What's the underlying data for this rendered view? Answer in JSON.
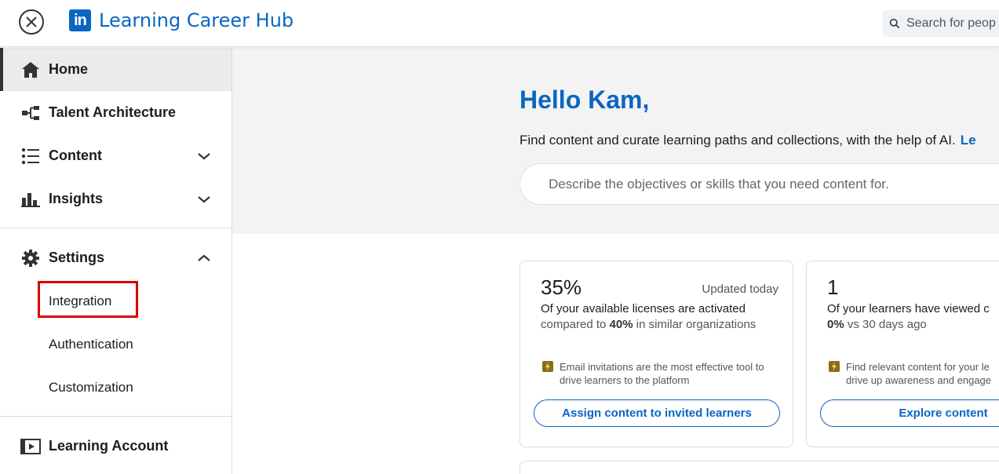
{
  "header": {
    "brand_logo_text": "in",
    "title": "Learning Career Hub",
    "search_placeholder": "Search for peop"
  },
  "sidebar": {
    "items": [
      {
        "label": "Home"
      },
      {
        "label": "Talent Architecture"
      },
      {
        "label": "Content"
      },
      {
        "label": "Insights"
      },
      {
        "label": "Settings"
      },
      {
        "label": "Learning Account"
      }
    ],
    "settings_sub": [
      {
        "label": "Integration"
      },
      {
        "label": "Authentication"
      },
      {
        "label": "Customization"
      }
    ]
  },
  "hero": {
    "greeting": "Hello Kam,",
    "intro": "Find content and curate learning paths and collections, with the help of AI.",
    "intro_link": "Le",
    "prompt_placeholder": "Describe the objectives or skills that you need content for."
  },
  "cards": [
    {
      "big": "35%",
      "updated": "Updated today",
      "line1": "Of your available licenses are activated",
      "line2_prefix": "compared to ",
      "line2_bold": "40%",
      "line2_suffix": " in similar organizations",
      "tip": "Email invitations are the most effective tool to drive learners to the platform",
      "button": "Assign content to invited learners"
    },
    {
      "big": "1",
      "line1": "Of your learners have viewed c",
      "line2_bold": "0%",
      "line2_suffix": " vs 30 days ago",
      "tip_line1": "Find relevant content for your le",
      "tip_line2": "drive up awareness and engage",
      "button": "Explore content"
    }
  ],
  "colors": {
    "brand_blue": "#0a66c2",
    "highlight_red": "#d90000"
  }
}
